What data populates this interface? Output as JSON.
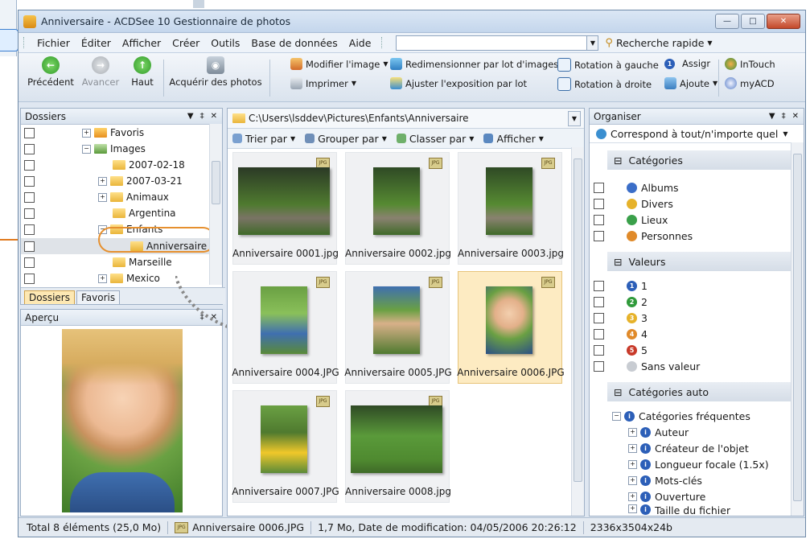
{
  "window": {
    "title": "Anniversaire - ACDSee 10 Gestionnaire de photos"
  },
  "menu": [
    "Fichier",
    "Éditer",
    "Afficher",
    "Créer",
    "Outils",
    "Base de données",
    "Aide"
  ],
  "search": {
    "quick_label": "Recherche rapide"
  },
  "toolbar": {
    "back": "Précédent",
    "forward": "Avancer",
    "up": "Haut",
    "acquire": "Acquérir des photos",
    "edit_image": "Modifier l'image",
    "print": "Imprimer",
    "batch_resize": "Redimensionner par lot d'images",
    "adjust_exposure": "Ajuster l'exposition par lot",
    "rotate_left": "Rotation à gauche",
    "rotate_right": "Rotation à droite",
    "assign": "Assigr",
    "add": "Ajoute",
    "intouch": "InTouch",
    "myacd": "myACD"
  },
  "folders": {
    "title": "Dossiers",
    "items": [
      "Favoris",
      "Images",
      "2007-02-18",
      "2007-03-21",
      "Animaux",
      "Argentina",
      "Enfants",
      "Anniversaire",
      "Marseille",
      "Mexico"
    ],
    "tabs": [
      "Dossiers",
      "Favoris"
    ]
  },
  "preview": {
    "title": "Aperçu"
  },
  "browser": {
    "path": "C:\\Users\\lsddev\\Pictures\\Enfants\\Anniversaire",
    "sort": "Trier par",
    "group": "Grouper par",
    "filter": "Classer par",
    "view": "Afficher",
    "files": [
      "Anniversaire 0001.jpg",
      "Anniversaire 0002.jpg",
      "Anniversaire 0003.jpg",
      "Anniversaire 0004.JPG",
      "Anniversaire 0005.JPG",
      "Anniversaire 0006.JPG",
      "Anniversaire 0007.JPG",
      "Anniversaire 0008.jpg"
    ],
    "jpg_tag": "JPG"
  },
  "organizer": {
    "title": "Organiser",
    "match": "Correspond à tout/n'importe quel",
    "categories_title": "Catégories",
    "categories": [
      "Albums",
      "Divers",
      "Lieux",
      "Personnes"
    ],
    "ratings_title": "Valeurs",
    "ratings": [
      "1",
      "2",
      "3",
      "4",
      "5",
      "Sans valeur"
    ],
    "auto_title": "Catégories auto",
    "auto_items": [
      "Catégories fréquentes",
      "Auteur",
      "Créateur de l'objet",
      "Longueur focale (1.5x)",
      "Mots-clés",
      "Ouverture",
      "Taille du fichier"
    ]
  },
  "status": {
    "total": "Total 8 éléments  (25,0 Mo)",
    "file": "Anniversaire 0006.JPG",
    "info": "1,7 Mo, Date de modification: 04/05/2006 20:26:12",
    "dims": "2336x3504x24b"
  },
  "colors": {
    "accent": "#e6902f",
    "selection": "#fdebc2",
    "panel_border": "#9fb1c7"
  }
}
